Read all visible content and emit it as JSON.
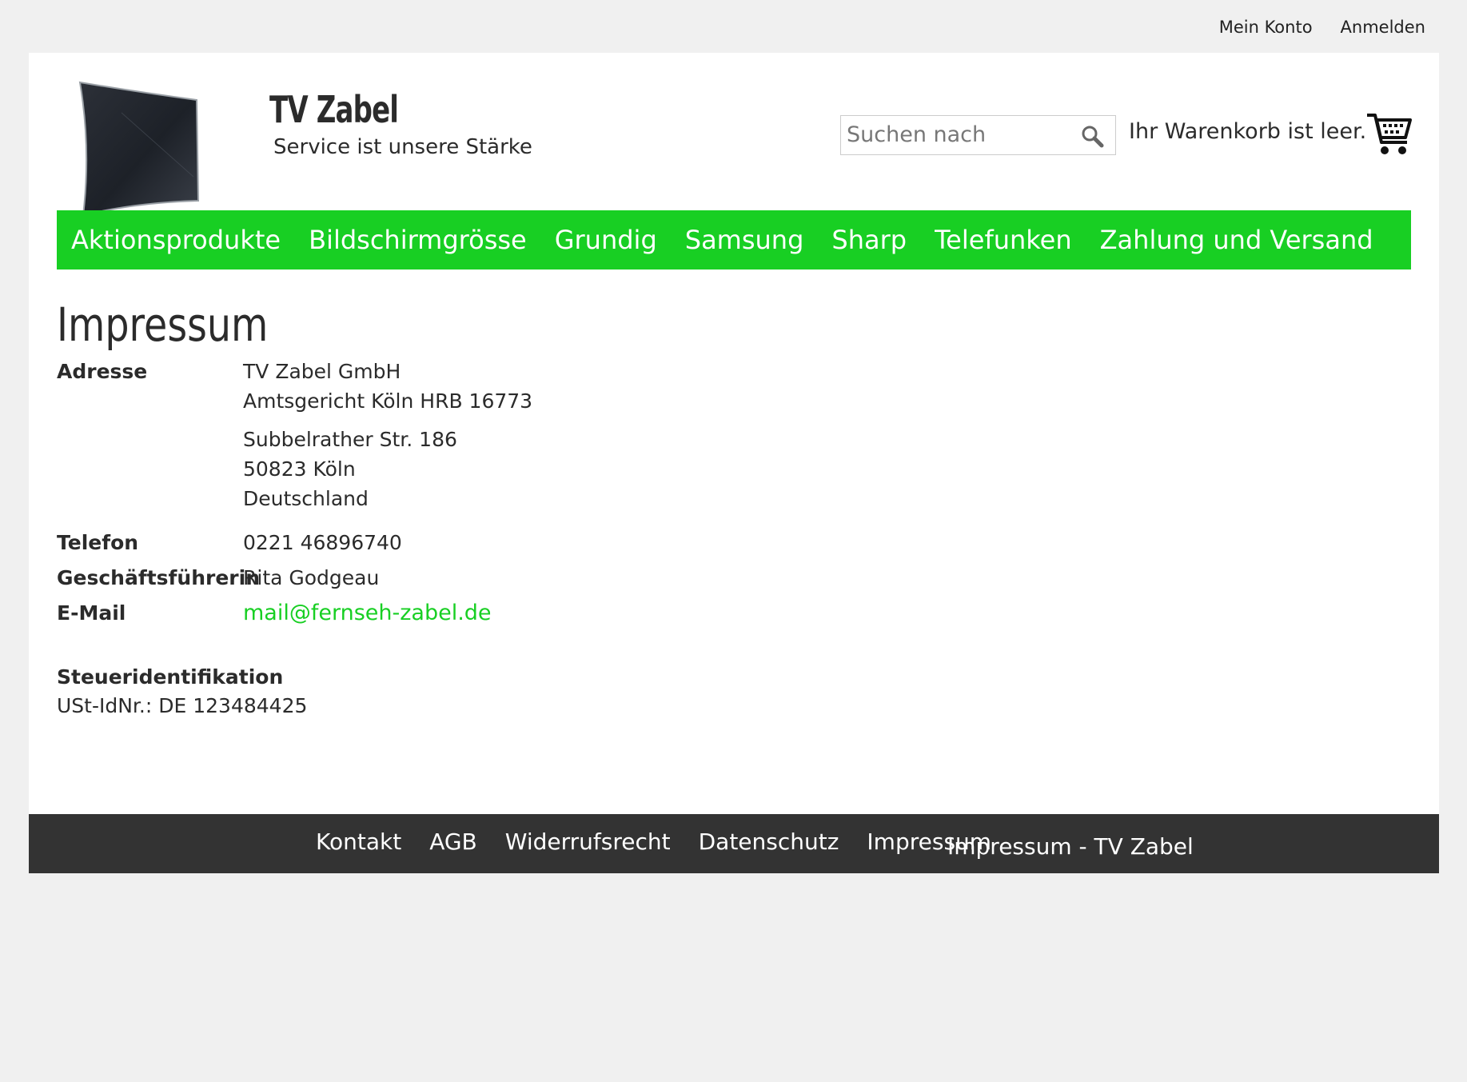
{
  "topbar": {
    "account": "Mein Konto",
    "login": "Anmelden"
  },
  "header": {
    "title": "TV Zabel",
    "tagline": "Service ist unsere Stärke",
    "search_placeholder": "Suchen nach",
    "cart_text": "Ihr Warenkorb ist leer."
  },
  "nav": {
    "items": [
      "Aktionsprodukte",
      "Bildschirmgrösse",
      "Grundig",
      "Samsung",
      "Sharp",
      "Telefunken",
      "Zahlung und Versand"
    ]
  },
  "content": {
    "title": "Impressum",
    "address_label": "Adresse",
    "address_lines": [
      "TV Zabel GmbH",
      "Amtsgericht Köln HRB 16773",
      "Subbelrather Str. 186",
      "50823 Köln",
      "Deutschland"
    ],
    "phone_label": "Telefon",
    "phone": "0221 46896740",
    "manager_label": "Geschäftsführerin",
    "manager": "Rita Godgeau",
    "email_label": "E-Mail",
    "email": "mail@fernseh-zabel.de",
    "tax_heading": "Steueridentifikation",
    "tax_value": "USt-IdNr.: DE 123484425"
  },
  "footer": {
    "links": [
      "Kontakt",
      "AGB",
      "Widerrufsrecht",
      "Datenschutz",
      "Impressum"
    ],
    "title": "Impressum - TV Zabel"
  },
  "colors": {
    "accent": "#18cf23",
    "footer_bg": "#333333",
    "page_bg": "#f0f0f0"
  },
  "icons": [
    "tv-logo-icon",
    "search-icon",
    "cart-icon"
  ]
}
